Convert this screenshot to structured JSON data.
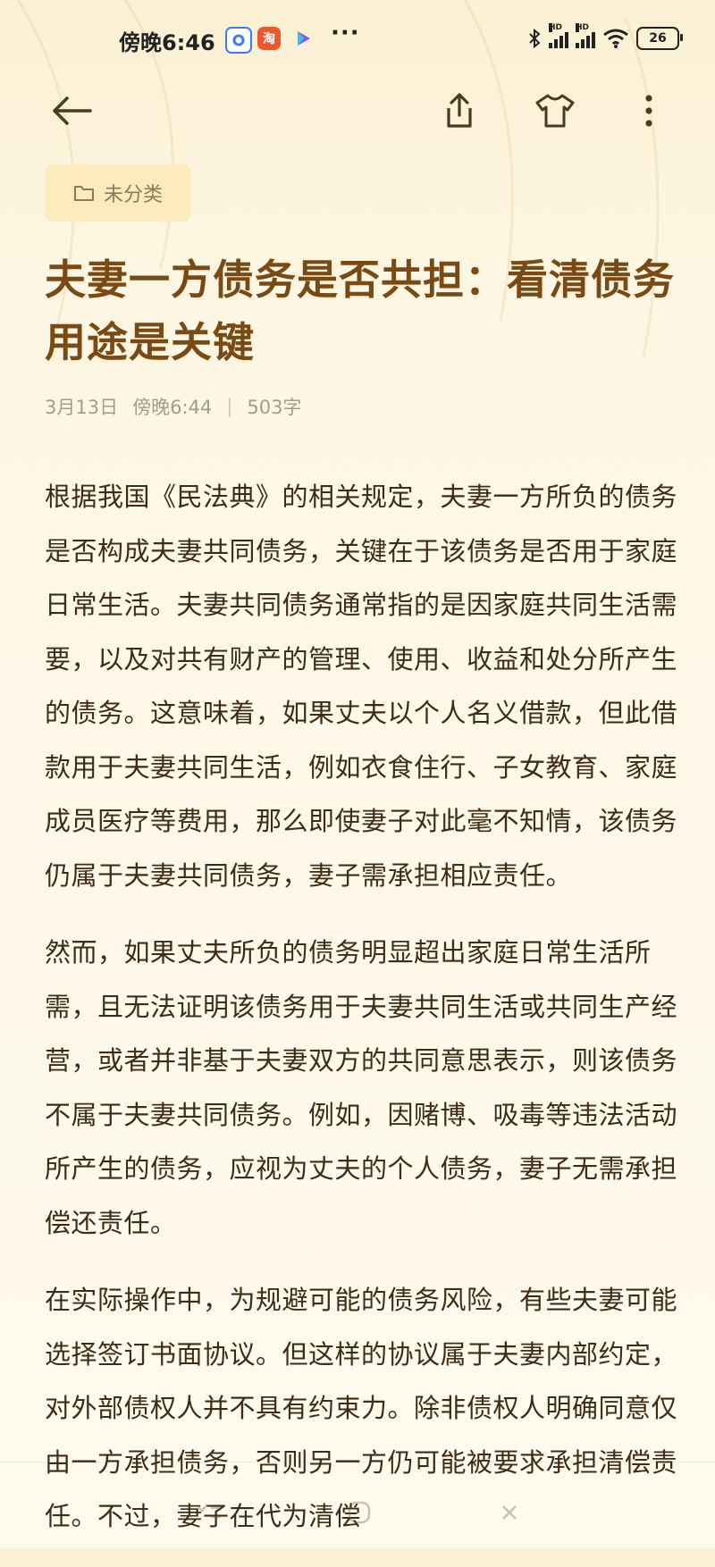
{
  "status_bar": {
    "time": "傍晚6:46",
    "app_badge": "淘",
    "more": "···",
    "hd_label": "HD",
    "battery": "26"
  },
  "toolbar": {
    "back_icon": "arrow-left-icon",
    "share_icon": "share-icon",
    "theme_icon": "tshirt-icon",
    "more_icon": "more-vertical-icon"
  },
  "note": {
    "category": "未分类",
    "title": "夫妻一方债务是否共担：看清债务用途是关键",
    "date": "3月13日",
    "time": "傍晚6:44",
    "separator": "|",
    "word_count": "503字",
    "paragraphs": [
      "根据我国《民法典》的相关规定，夫妻一方所负的债务是否构成夫妻共同债务，关键在于该债务是否用于家庭日常生活。夫妻共同债务通常指的是因家庭共同生活需要，以及对共有财产的管理、使用、收益和处分所产生的债务。这意味着，如果丈夫以个人名义借款，但此借款用于夫妻共同生活，例如衣食住行、子女教育、家庭成员医疗等费用，那么即使妻子对此毫不知情，该债务仍属于夫妻共同债务，妻子需承担相应责任。",
      "然而，如果丈夫所负的债务明显超出家庭日常生活所需，且无法证明该债务用于夫妻共同生活或共同生产经营，或者并非基于夫妻双方的共同意思表示，则该债务不属于夫妻共同债务。例如，因赌博、吸毒等违法活动所产生的债务，应视为丈夫的个人债务，妻子无需承担偿还责任。",
      "在实际操作中，为规避可能的债务风险，有些夫妻可能选择签订书面协议。但这样的协议属于夫妻内部约定，对外部债权人并不具有约束力。除非债权人明确同意仅由一方承担债务，否则另一方仍可能被要求承担清偿责任。不过，妻子在代为清偿"
    ]
  },
  "colors": {
    "title": "#7a4a14",
    "body_text": "#3f2c15",
    "meta": "#a39b8b",
    "chip_bg": "#fbe9b7"
  }
}
